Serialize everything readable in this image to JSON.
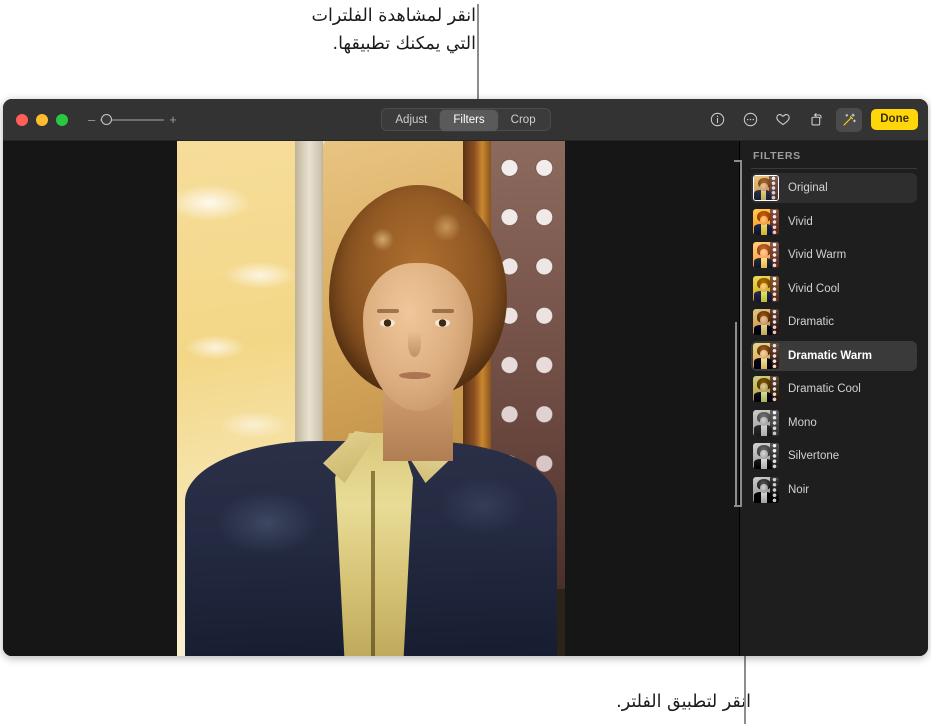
{
  "callouts": {
    "top": "انقر لمشاهدة الفلترات\nالتي يمكنك تطبيقها.",
    "bottom": "انقر لتطبيق الفلتر."
  },
  "window": {
    "traffic_lights": {
      "close_label": "Close",
      "minimize_label": "Minimize",
      "maximize_label": "Zoom"
    },
    "zoom_slider": {
      "minus_label": "–",
      "plus_label": "+",
      "value_percent": 8
    },
    "tabs": [
      {
        "label": "Adjust",
        "selected": false
      },
      {
        "label": "Filters",
        "selected": true
      },
      {
        "label": "Crop",
        "selected": false
      }
    ],
    "toolbar_icons": [
      {
        "name": "info-icon",
        "glyph": "info",
        "active": false
      },
      {
        "name": "more-options-icon",
        "glyph": "more",
        "active": false
      },
      {
        "name": "favorite-icon",
        "glyph": "heart",
        "active": false
      },
      {
        "name": "rotate-icon",
        "glyph": "rotate",
        "active": false
      },
      {
        "name": "auto-enhance-icon",
        "glyph": "wand",
        "active": true
      }
    ],
    "done_label": "Done"
  },
  "sidebar": {
    "heading": "FILTERS",
    "filters": [
      {
        "label": "Original",
        "look": "lk-original",
        "current": true,
        "selected": false,
        "hovered": true
      },
      {
        "label": "Vivid",
        "look": "lk-vivid",
        "current": false,
        "selected": false,
        "hovered": false
      },
      {
        "label": "Vivid Warm",
        "look": "lk-vividwarm",
        "current": false,
        "selected": false,
        "hovered": false
      },
      {
        "label": "Vivid Cool",
        "look": "lk-vividcool",
        "current": false,
        "selected": false,
        "hovered": false
      },
      {
        "label": "Dramatic",
        "look": "lk-dramatic",
        "current": false,
        "selected": false,
        "hovered": false
      },
      {
        "label": "Dramatic Warm",
        "look": "lk-dramaticwarm",
        "current": false,
        "selected": true,
        "hovered": false
      },
      {
        "label": "Dramatic Cool",
        "look": "lk-dramaticcool",
        "current": false,
        "selected": false,
        "hovered": false
      },
      {
        "label": "Mono",
        "look": "lk-mono",
        "current": false,
        "selected": false,
        "hovered": false
      },
      {
        "label": "Silvertone",
        "look": "lk-silvertone",
        "current": false,
        "selected": false,
        "hovered": false
      },
      {
        "label": "Noir",
        "look": "lk-noir",
        "current": false,
        "selected": false,
        "hovered": false
      }
    ]
  },
  "colors": {
    "accent_done": "#ffd60a",
    "window_bg": "#1e1e1e",
    "toolbar_bg": "#333333",
    "selected_row": "#3a3a3a",
    "callout_leader": "#8d8d8d",
    "traffic_close": "#ff5f57",
    "traffic_min": "#febc2e",
    "traffic_max": "#28c840"
  }
}
